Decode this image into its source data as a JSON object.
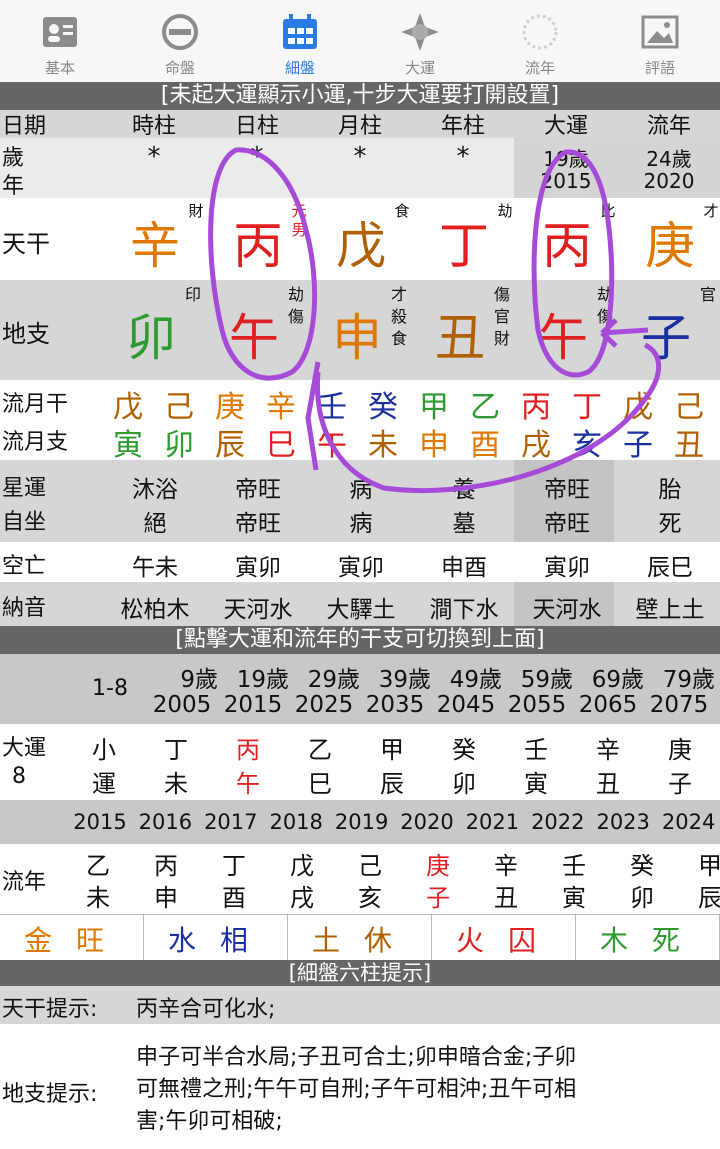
{
  "tabs": [
    "基本",
    "命盤",
    "細盤",
    "大運",
    "流年",
    "評語"
  ],
  "colors": {
    "wood": "#2f9a2f",
    "fire": "#e02020",
    "earth": "#b06000",
    "metal": "#e07800",
    "water": "#1a2fa0",
    "accent": "#2a7be4",
    "annotation": "#a64bd8"
  },
  "banner1": "[未起大運顯示小運,十步大運要打開設置]",
  "header": [
    "日期",
    "時柱",
    "日柱",
    "月柱",
    "年柱",
    "大運",
    "流年"
  ],
  "age_label": [
    "歲",
    "年"
  ],
  "stars": [
    "*",
    "*",
    "*",
    "*"
  ],
  "dayun_age": "19歲",
  "dayun_year": "2015",
  "liunian_age": "24歲",
  "liunian_year": "2020",
  "tiangan_label": "天干",
  "tiangan": [
    {
      "c": "辛",
      "color": "#e07800",
      "sup": "財"
    },
    {
      "c": "丙",
      "color": "#e02020",
      "sup": "元男"
    },
    {
      "c": "戊",
      "color": "#b06000",
      "sup": "食"
    },
    {
      "c": "丁",
      "color": "#e02020",
      "sup": "劫"
    },
    {
      "c": "丙",
      "color": "#e02020",
      "sup": "比"
    },
    {
      "c": "庚",
      "color": "#e07800",
      "sup": "才"
    }
  ],
  "dizhi_label": "地支",
  "dizhi": [
    {
      "c": "卯",
      "color": "#2f9a2f",
      "sup": "印"
    },
    {
      "c": "午",
      "color": "#e02020",
      "sup": "劫傷"
    },
    {
      "c": "申",
      "color": "#e07800",
      "sup": "才殺食"
    },
    {
      "c": "丑",
      "color": "#b06000",
      "sup": "傷官財"
    },
    {
      "c": "午",
      "color": "#e02020",
      "sup": "劫傷"
    },
    {
      "c": "子",
      "color": "#1a2fa0",
      "sup": "官"
    }
  ],
  "liuyue_gan_label": "流月干",
  "liuyue_zhi_label": "流月支",
  "liuyue_gan": [
    {
      "c": "戊",
      "color": "#b06000"
    },
    {
      "c": "己",
      "color": "#b06000"
    },
    {
      "c": "庚",
      "color": "#e07800"
    },
    {
      "c": "辛",
      "color": "#e07800"
    },
    {
      "c": "壬",
      "color": "#1a2fa0"
    },
    {
      "c": "癸",
      "color": "#1a2fa0"
    },
    {
      "c": "甲",
      "color": "#2f9a2f"
    },
    {
      "c": "乙",
      "color": "#2f9a2f"
    },
    {
      "c": "丙",
      "color": "#e02020"
    },
    {
      "c": "丁",
      "color": "#e02020"
    },
    {
      "c": "戊",
      "color": "#b06000"
    },
    {
      "c": "己",
      "color": "#b06000"
    }
  ],
  "liuyue_zhi": [
    {
      "c": "寅",
      "color": "#2f9a2f"
    },
    {
      "c": "卯",
      "color": "#2f9a2f"
    },
    {
      "c": "辰",
      "color": "#b06000"
    },
    {
      "c": "巳",
      "color": "#e02020"
    },
    {
      "c": "午",
      "color": "#e02020"
    },
    {
      "c": "未",
      "color": "#b06000"
    },
    {
      "c": "申",
      "color": "#e07800"
    },
    {
      "c": "酉",
      "color": "#e07800"
    },
    {
      "c": "戌",
      "color": "#b06000"
    },
    {
      "c": "亥",
      "color": "#1a2fa0"
    },
    {
      "c": "子",
      "color": "#1a2fa0"
    },
    {
      "c": "丑",
      "color": "#b06000"
    }
  ],
  "xingyun_label": [
    "星運",
    "自坐"
  ],
  "xingyun": [
    [
      "沐浴",
      "絕"
    ],
    [
      "帝旺",
      "帝旺"
    ],
    [
      "病",
      "病"
    ],
    [
      "養",
      "墓"
    ],
    [
      "帝旺",
      "帝旺"
    ],
    [
      "胎",
      "死"
    ]
  ],
  "kongwang_label": "空亡",
  "kongwang": [
    "午未",
    "寅卯",
    "寅卯",
    "申酉",
    "寅卯",
    "辰巳"
  ],
  "nayin_label": "納音",
  "nayin": [
    "松柏木",
    "天河水",
    "大驛土",
    "澗下水",
    "天河水",
    "壁上土"
  ],
  "banner2": "[點擊大運和流年的干支可切換到上面]",
  "dayun_range": "1-8",
  "dayun_ages": [
    "9歲",
    "19歲",
    "29歲",
    "39歲",
    "49歲",
    "59歲",
    "69歲",
    "79歲"
  ],
  "dayun_years": [
    "2005",
    "2015",
    "2025",
    "2035",
    "2045",
    "2055",
    "2065",
    "2075"
  ],
  "dayun_label": [
    "大運",
    "8"
  ],
  "dayun_list": [
    {
      "g": "小",
      "z": "運",
      "red": false
    },
    {
      "g": "丁",
      "z": "未",
      "red": false
    },
    {
      "g": "丙",
      "z": "午",
      "red": true
    },
    {
      "g": "乙",
      "z": "巳",
      "red": false
    },
    {
      "g": "甲",
      "z": "辰",
      "red": false
    },
    {
      "g": "癸",
      "z": "卯",
      "red": false
    },
    {
      "g": "壬",
      "z": "寅",
      "red": false
    },
    {
      "g": "辛",
      "z": "丑",
      "red": false
    },
    {
      "g": "庚",
      "z": "子",
      "red": false
    }
  ],
  "liunian_years": [
    "2015",
    "2016",
    "2017",
    "2018",
    "2019",
    "2020",
    "2021",
    "2022",
    "2023",
    "2024"
  ],
  "liunian_label": "流年",
  "liunian_list": [
    {
      "g": "乙",
      "z": "未",
      "red": false
    },
    {
      "g": "丙",
      "z": "申",
      "red": false
    },
    {
      "g": "丁",
      "z": "酉",
      "red": false
    },
    {
      "g": "戊",
      "z": "戌",
      "red": false
    },
    {
      "g": "己",
      "z": "亥",
      "red": false
    },
    {
      "g": "庚",
      "z": "子",
      "red": true
    },
    {
      "g": "辛",
      "z": "丑",
      "red": false
    },
    {
      "g": "壬",
      "z": "寅",
      "red": false
    },
    {
      "g": "癸",
      "z": "卯",
      "red": false
    },
    {
      "g": "甲",
      "z": "辰",
      "red": false
    }
  ],
  "wangxiang": [
    {
      "e": "金",
      "s": "旺",
      "color": "#e07800"
    },
    {
      "e": "水",
      "s": "相",
      "color": "#1a2fa0"
    },
    {
      "e": "土",
      "s": "休",
      "color": "#b06000"
    },
    {
      "e": "火",
      "s": "囚",
      "color": "#e02020"
    },
    {
      "e": "木",
      "s": "死",
      "color": "#2f9a2f"
    }
  ],
  "banner3": "[細盤六柱提示]",
  "tg_hint_label": "天干提示:",
  "tg_hint": "丙辛合可化水;",
  "dz_hint_label": "地支提示:",
  "dz_hint": [
    "申子可半合水局;子丑可合土;卯申暗合金;子卯",
    "可無禮之刑;午午可自刑;子午可相沖;丑午可相",
    "害;午卯可相破;"
  ]
}
